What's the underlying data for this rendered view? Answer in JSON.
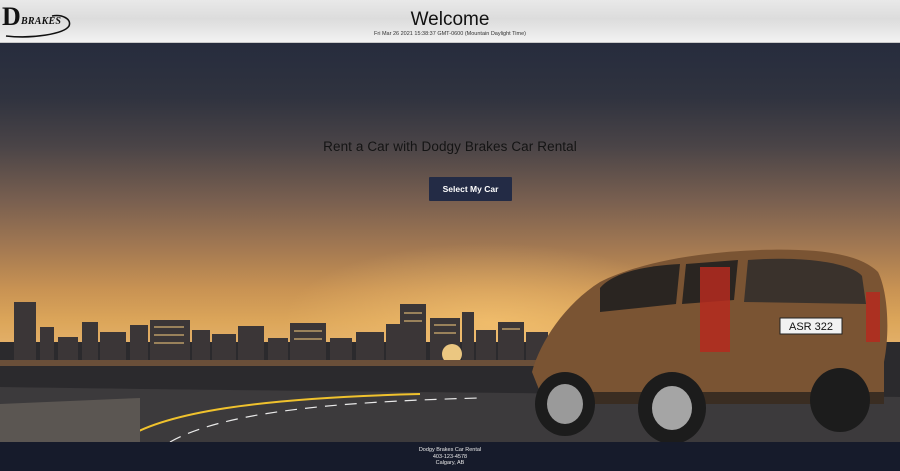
{
  "header": {
    "logo_letter": "D",
    "logo_word": "BRAKES",
    "title": "Welcome",
    "datetime": "Fri Mar 26 2021 15:38:37 GMT-0600 (Mountain Daylight Time)"
  },
  "hero": {
    "tagline": "Rent a Car with Dodgy Brakes Car Rental",
    "cta_label": "Select My Car",
    "license_plate": "ASR 322"
  },
  "footer": {
    "company": "Dodgy Brakes Car Rental",
    "phone": "403-123-4578",
    "location": "Calgary, AB"
  },
  "colors": {
    "header_bg": "#e4e4e4",
    "cta_bg": "#232b45",
    "footer_bg": "#161b2b"
  }
}
